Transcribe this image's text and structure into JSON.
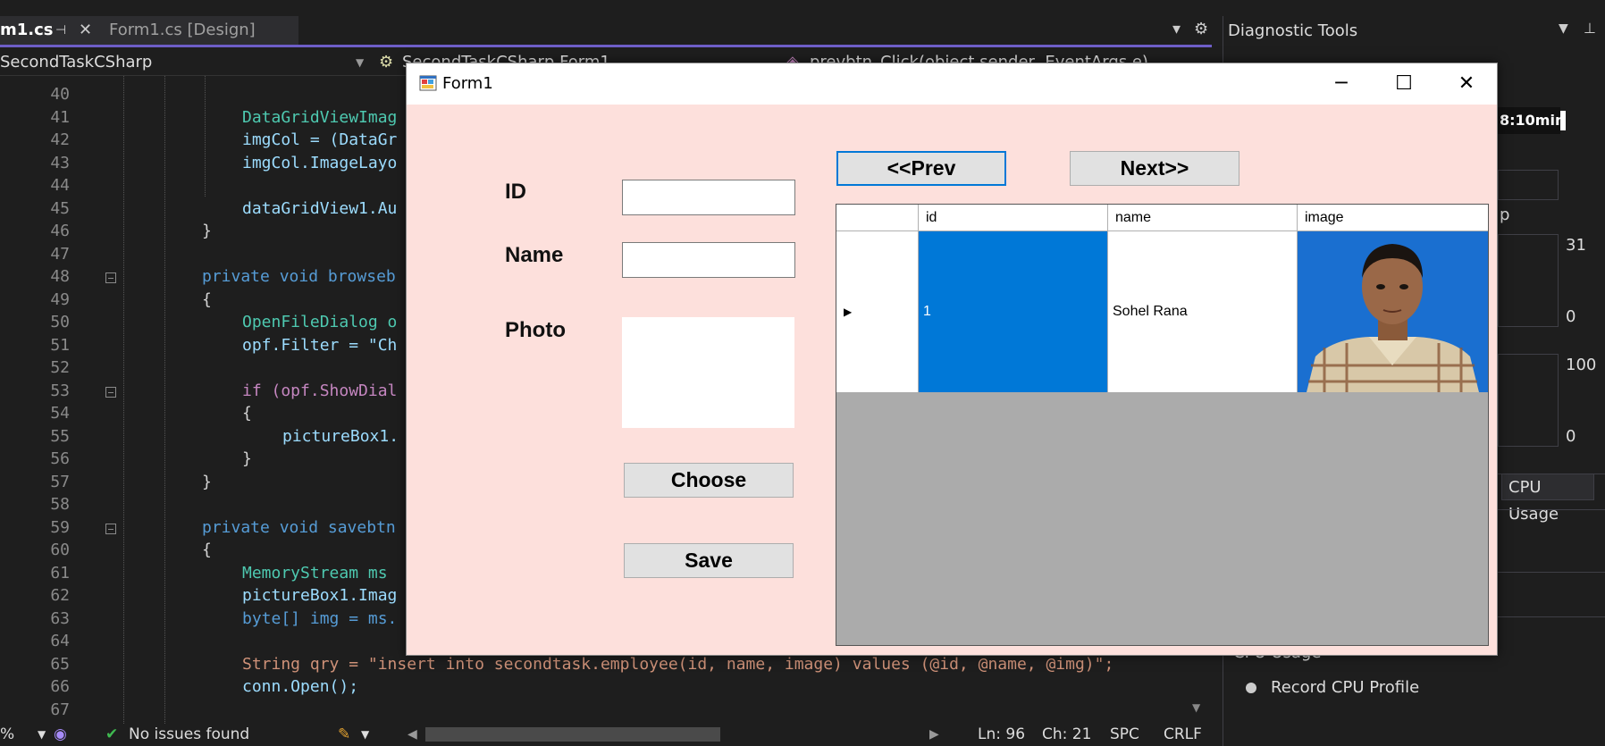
{
  "ide": {
    "tabs": [
      {
        "label": "m1.cs",
        "active": true
      },
      {
        "label": "Form1.cs [Design]",
        "active": false
      }
    ],
    "nav": {
      "project": "SecondTaskCSharp",
      "class": "SecondTaskCSharp.Form1",
      "member": "prevbtn_Click(object sender, EventArgs e)"
    },
    "code_lines": [
      {
        "n": "40",
        "text": ""
      },
      {
        "n": "41",
        "text": "DataGridViewImag"
      },
      {
        "n": "42",
        "text": "imgCol = (DataGr"
      },
      {
        "n": "43",
        "text": "imgCol.ImageLayo"
      },
      {
        "n": "44",
        "text": ""
      },
      {
        "n": "45",
        "text": "dataGridView1.Au"
      },
      {
        "n": "46",
        "text": "}"
      },
      {
        "n": "47",
        "text": ""
      },
      {
        "n": "48",
        "text": "private void browseb"
      },
      {
        "n": "49",
        "text": "{"
      },
      {
        "n": "50",
        "text": "OpenFileDialog o"
      },
      {
        "n": "51",
        "text": "opf.Filter = \"Ch"
      },
      {
        "n": "52",
        "text": ""
      },
      {
        "n": "53",
        "text": "if (opf.ShowDial"
      },
      {
        "n": "54",
        "text": "{"
      },
      {
        "n": "55",
        "text": "pictureBox1."
      },
      {
        "n": "56",
        "text": "}"
      },
      {
        "n": "57",
        "text": "}"
      },
      {
        "n": "58",
        "text": ""
      },
      {
        "n": "59",
        "text": "private void savebtn"
      },
      {
        "n": "60",
        "text": "{"
      },
      {
        "n": "61",
        "text": "MemoryStream ms"
      },
      {
        "n": "62",
        "text": "pictureBox1.Imag"
      },
      {
        "n": "63",
        "text": "byte[] img = ms."
      },
      {
        "n": "64",
        "text": ""
      },
      {
        "n": "65",
        "text": "String qry = \"insert into secondtask.employee(id, name, image) values (@id, @name, @img)\";"
      },
      {
        "n": "66",
        "text": "conn.Open();"
      },
      {
        "n": "67",
        "text": ""
      }
    ],
    "status": {
      "zoom": "%",
      "issues": "No issues found",
      "ln": "Ln: 96",
      "ch": "Ch: 21",
      "spc": "SPC",
      "crlf": "CRLF"
    }
  },
  "diagnostic": {
    "title": "Diagnostic Tools",
    "time": "8:10min",
    "p_text": "p",
    "mem_max": "31",
    "mem_min": "0",
    "cpu_max": "100",
    "cpu_min": "0",
    "tab_cpu": "CPU Usage",
    "section_cpu": "CPU Usage",
    "record_cpu": "Record CPU Profile"
  },
  "form": {
    "title": "Form1",
    "labels": {
      "id": "ID",
      "name": "Name",
      "photo": "Photo"
    },
    "inputs": {
      "id": "",
      "name": ""
    },
    "buttons": {
      "choose": "Choose",
      "save": "Save",
      "prev": "<<Prev",
      "next": "Next>>"
    },
    "grid": {
      "columns": [
        "id",
        "name",
        "image"
      ],
      "rows": [
        {
          "id": "1",
          "name": "Sohel Rana",
          "image": "photo"
        }
      ]
    }
  }
}
